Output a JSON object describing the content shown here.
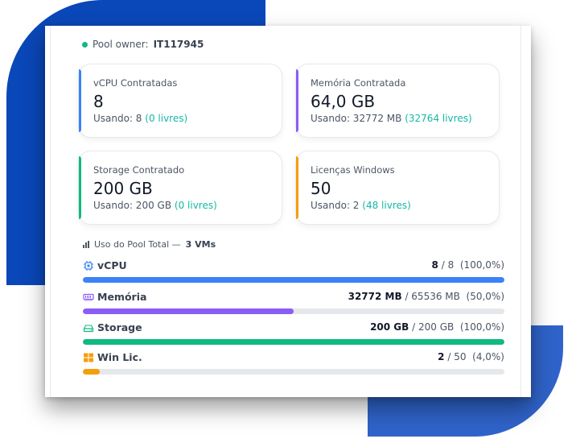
{
  "owner": {
    "label": "Pool owner:",
    "id": "IT117945",
    "status_color": "#10b981"
  },
  "stats": [
    {
      "label": "vCPU Contratadas",
      "value": "8",
      "usage_prefix": "Usando: 8",
      "usage_free": "(0 livres)",
      "accent": "#3b82f6"
    },
    {
      "label": "Memória Contratada",
      "value": "64,0 GB",
      "usage_prefix": "Usando: 32772 MB",
      "usage_free": "(32764 livres)",
      "accent": "#8b5cf6"
    },
    {
      "label": "Storage Contratado",
      "value": "200 GB",
      "usage_prefix": "Usando: 200 GB",
      "usage_free": "(0 livres)",
      "accent": "#10b981"
    },
    {
      "label": "Licenças Windows",
      "value": "50",
      "usage_prefix": "Usando: 2",
      "usage_free": "(48 livres)",
      "accent": "#f59e0b"
    }
  ],
  "pool": {
    "title_prefix": "Uso do Pool Total —",
    "title_vms": "3 VMs",
    "rows": [
      {
        "name": "vCPU",
        "icon": "cpu-icon",
        "used": "8",
        "total": "/ 8",
        "percent_text": "(100,0%)",
        "percent": 100.0,
        "color": "#3b82f6"
      },
      {
        "name": "Memória",
        "icon": "memory-icon",
        "used": "32772 MB",
        "total": "/ 65536 MB",
        "percent_text": "(50,0%)",
        "percent": 50.0,
        "color": "#8b5cf6"
      },
      {
        "name": "Storage",
        "icon": "hdd-icon",
        "used": "200 GB",
        "total": "/ 200 GB",
        "percent_text": "(100,0%)",
        "percent": 100.0,
        "color": "#10b981"
      },
      {
        "name": "Win Lic.",
        "icon": "windows-icon",
        "used": "2",
        "total": "/ 50",
        "percent_text": "(4,0%)",
        "percent": 4.0,
        "color": "#f59e0b"
      }
    ]
  },
  "colors": {
    "brand_dark": "#0a47b8",
    "brand_light": "#2f63c9",
    "free_text": "#14b8a6"
  }
}
